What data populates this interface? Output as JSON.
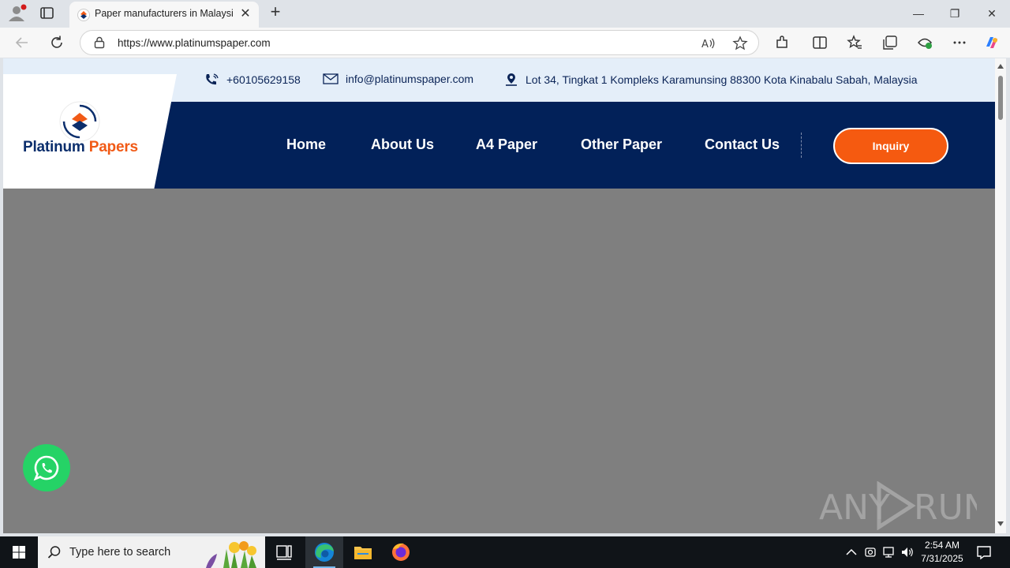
{
  "browser": {
    "tab_title": "Paper manufacturers in Malaysia, ",
    "url": "https://www.platinumspaper.com",
    "tab_close_label": "✕",
    "new_tab_label": "+",
    "window_min": "—",
    "window_restore": "❐",
    "window_close": "✕"
  },
  "page": {
    "phone": "+60105629158",
    "email": "info@platinumspaper.com",
    "address": "Lot 34, Tingkat 1 Kompleks Karamunsing 88300 Kota Kinabalu Sabah, Malaysia",
    "logo": {
      "part1": "Platinum ",
      "part2": "Papers"
    },
    "nav": [
      "Home",
      "About Us",
      "A4 Paper",
      "Other Paper",
      "Contact Us"
    ],
    "inquiry_label": "Inquiry",
    "colors": {
      "navy": "#022159",
      "orange": "#f55a10",
      "info_bar": "#e4eef9",
      "hero_placeholder": "#7f7f7f",
      "whatsapp": "#25d366"
    }
  },
  "watermark": "ANY RUN",
  "taskbar": {
    "search_placeholder": "Type here to search",
    "time": "2:54 AM",
    "date": "7/31/2025"
  }
}
